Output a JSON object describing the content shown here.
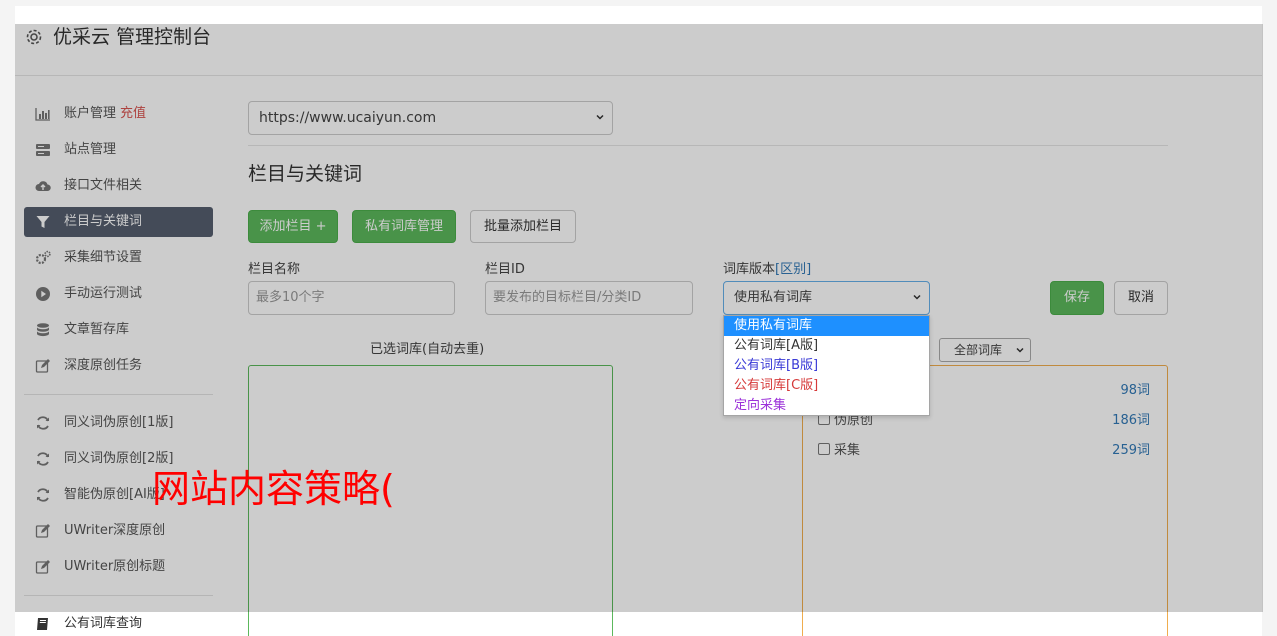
{
  "header": {
    "title": "优采云 管理控制台",
    "icon": "gear-icon"
  },
  "sidebar": {
    "items": [
      {
        "label": "账户管理",
        "badge": "充值",
        "icon": "bar-chart-icon"
      },
      {
        "label": "站点管理",
        "icon": "server-icon"
      },
      {
        "label": "接口文件相关",
        "icon": "cloud-upload-icon"
      },
      {
        "label": "栏目与关键词",
        "icon": "filter-icon",
        "active": true
      },
      {
        "label": "采集细节设置",
        "icon": "cogs-icon"
      },
      {
        "label": "手动运行测试",
        "icon": "play-circle-icon"
      },
      {
        "label": "文章暂存库",
        "icon": "database-icon"
      },
      {
        "label": "深度原创任务",
        "icon": "edit-icon"
      },
      {
        "label": "同义词伪原创[1版]",
        "icon": "refresh-icon"
      },
      {
        "label": "同义词伪原创[2版]",
        "icon": "refresh-icon"
      },
      {
        "label": "智能伪原创[AI版]",
        "icon": "refresh-icon"
      },
      {
        "label": "UWriter深度原创",
        "icon": "edit-icon"
      },
      {
        "label": "UWriter原创标题",
        "icon": "edit-icon"
      },
      {
        "label": "公有词库查询",
        "icon": "book-icon"
      }
    ]
  },
  "main": {
    "site_select": "https://www.ucaiyun.com",
    "section_title": "栏目与关键词",
    "buttons": {
      "add_column": "添加栏目 +",
      "private_lib": "私有词库管理",
      "batch_add": "批量添加栏目",
      "save": "保存",
      "cancel": "取消"
    },
    "fields": {
      "column_name_label": "栏目名称",
      "column_name_placeholder": "最多10个字",
      "column_id_label": "栏目ID",
      "column_id_placeholder": "要发布的目标栏目/分类ID",
      "lib_version_label": "词库版本",
      "lib_version_link": "[区别]",
      "lib_version_value": "使用私有词库"
    },
    "dropdown_options": [
      {
        "label": "使用私有词库",
        "color": "#ffffff",
        "selected": true
      },
      {
        "label": "公有词库[A版]",
        "color": "#333333"
      },
      {
        "label": "公有词库[B版]",
        "color": "#3a3ad6"
      },
      {
        "label": "公有词库[C版]",
        "color": "#d63a3a"
      },
      {
        "label": "定向采集",
        "color": "#9b30d9"
      }
    ],
    "selected_panel_label": "已选词库(自动去重)",
    "all_libs_select": "全部词库",
    "libraries": [
      {
        "name": "",
        "count": "98词"
      },
      {
        "name": "伪原创",
        "count": "186词"
      },
      {
        "name": "采集",
        "count": "259词"
      }
    ]
  },
  "watermark": "网站内容策略(",
  "colors": {
    "green": "#5cb85c",
    "orange": "#f0ad4e",
    "active_sidebar": "#555e6e",
    "link_blue": "#337ab7",
    "recharge_red": "#d9534f"
  }
}
